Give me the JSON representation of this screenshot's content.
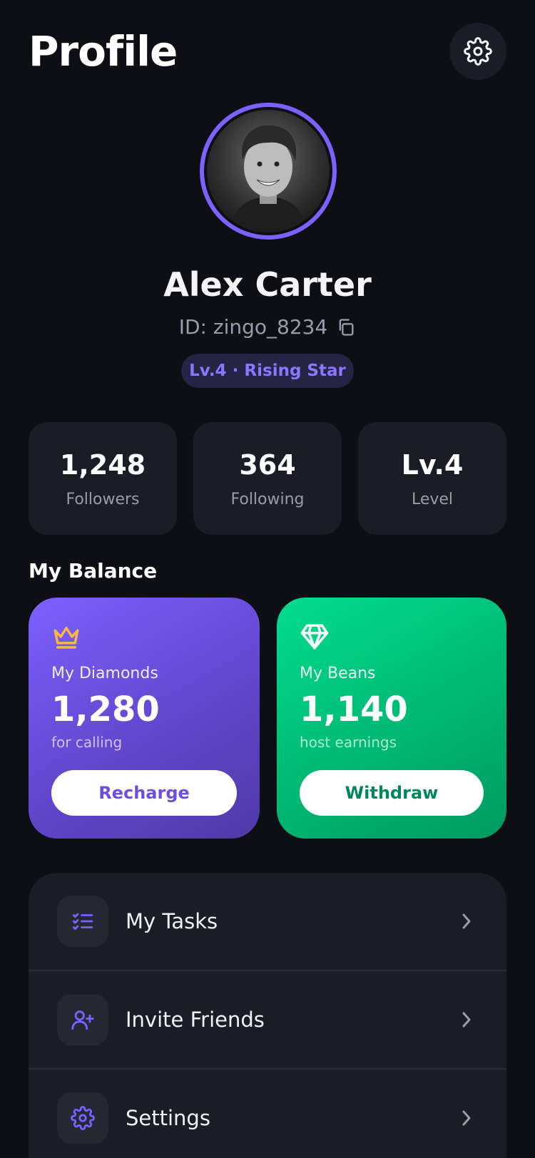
{
  "header": {
    "title": "Profile"
  },
  "profile": {
    "name": "Alex Carter",
    "id_text": "ID: zingo_8234",
    "badge": "Lv.4 · Rising Star"
  },
  "stats": [
    {
      "value": "1,248",
      "label": "Followers"
    },
    {
      "value": "364",
      "label": "Following"
    },
    {
      "value": "Lv.4",
      "label": "Level"
    }
  ],
  "balance": {
    "title": "My Balance",
    "diamonds": {
      "label": "My Diamonds",
      "value": "1,280",
      "sub": "for calling",
      "button": "Recharge",
      "icon": "crown-icon"
    },
    "beans": {
      "label": "My Beans",
      "value": "1,140",
      "sub": "host earnings",
      "button": "Withdraw",
      "icon": "diamond-icon"
    }
  },
  "menu": [
    {
      "label": "My Tasks",
      "icon": "tasks-icon"
    },
    {
      "label": "Invite Friends",
      "icon": "add-user-icon"
    },
    {
      "label": "Settings",
      "icon": "gear-icon"
    }
  ],
  "colors": {
    "background": "#0e0f14",
    "card": "#1b1d26",
    "accent_purple": "#7b61ff",
    "accent_green": "#00c982",
    "crown_yellow": "#f7b84b"
  }
}
